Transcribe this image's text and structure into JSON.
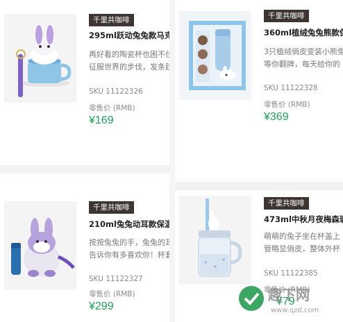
{
  "products": [
    {
      "tag": "千里共咖啡",
      "title": "295ml跃动兔兔款马克杯",
      "desc_lines": [
        "再好看的陶瓷杯也困不住",
        "征服世界的步伐，发条跃"
      ],
      "sku": "SKU 11122326",
      "price_label": "零售价 (RMB)",
      "price": "¥169",
      "image_icon": "bunny-mug-icon"
    },
    {
      "tag": "千里共咖啡",
      "title": "360ml植绒兔兔熊款保温杯",
      "desc_lines": [
        "3只植绒俏皮变装小熊兔",
        "等你翻牌，每天给你的"
      ],
      "sku": "SKU 11122328",
      "price_label": "零售价 (RMB)",
      "price": "¥369",
      "image_icon": "gift-box-tumbler-icon"
    },
    {
      "tag": "千里共咖啡",
      "title": "210ml兔兔动耳款保温杯",
      "desc_lines": [
        "按按兔兔的手，兔兔的耳",
        "告诉你有多喜欢你！杯套"
      ],
      "sku": "SKU 11122327",
      "price_label": "零售价 (RMB)",
      "price": "¥299",
      "image_icon": "plush-bunny-bottle-icon"
    },
    {
      "tag": "千里共咖啡",
      "title": "473ml中秋月夜梅森玻璃杯",
      "desc_lines": [
        "萌萌的兔子坐在杯盖上",
        "管略显俏皮，整体外杯"
      ],
      "sku": "SKU 11122385",
      "price_label": "零售价 (RMB)",
      "price": "¥79",
      "image_icon": "mason-jar-icon"
    }
  ],
  "watermark": {
    "brand": "趣下网",
    "url": "www.qzd.com"
  }
}
